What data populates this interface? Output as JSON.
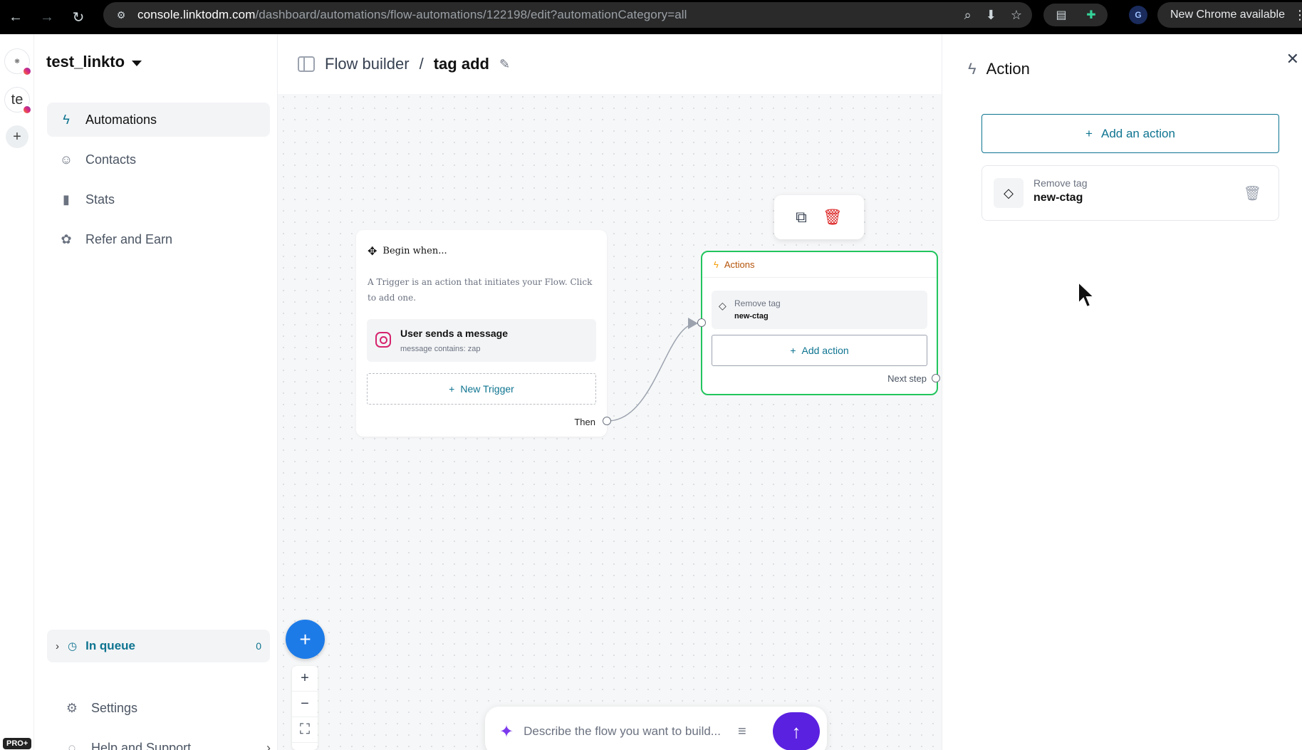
{
  "browser": {
    "url_host": "console.linktodm.com",
    "url_path": "/dashboard/automations/flow-automations/122198/edit?automationCategory=all",
    "profile_initial": "G",
    "update_label": "New Chrome available"
  },
  "rail": {
    "workspace2_initials": "te",
    "pro_badge": "PRO+"
  },
  "sidebar": {
    "workspace_name": "test_linkto",
    "items": [
      {
        "label": "Automations",
        "icon": "bolt-icon",
        "active": true
      },
      {
        "label": "Contacts",
        "icon": "contact-icon",
        "active": false
      },
      {
        "label": "Stats",
        "icon": "chart-icon",
        "active": false
      },
      {
        "label": "Refer and Earn",
        "icon": "gift-icon",
        "active": false
      }
    ],
    "queue": {
      "label": "In queue",
      "count": "0"
    },
    "settings_label": "Settings",
    "help_label": "Help and Support"
  },
  "header": {
    "crumb_parent": "Flow builder",
    "crumb_sep": "/",
    "crumb_current": "tag add"
  },
  "trigger_card": {
    "title": "Begin when...",
    "description": "A Trigger is an action that initiates your Flow. Click to add one.",
    "item_title": "User sends a message",
    "item_sub": "message contains: zap",
    "new_trigger_label": "New Trigger",
    "then_label": "Then"
  },
  "action_card": {
    "title": "Actions",
    "item_label": "Remove tag",
    "item_value": "new-ctag",
    "add_label": "Add action",
    "next_label": "Next step"
  },
  "ai_bar": {
    "placeholder": "Describe the flow you want to build..."
  },
  "panel": {
    "title": "Action",
    "add_label": "Add an action",
    "item_label": "Remove tag",
    "item_value": "new-ctag"
  },
  "colors": {
    "accent": "#0e7490",
    "success": "#22c55e",
    "danger": "#dc2626",
    "fab": "#1d7be8",
    "ai_send": "#5b21e0"
  }
}
